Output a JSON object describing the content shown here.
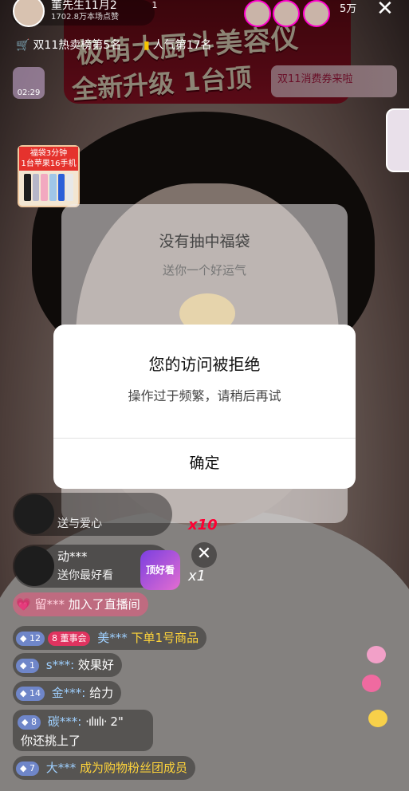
{
  "header": {
    "host_name": "董先生11月2",
    "host_likes": "1702.8万本场点赞",
    "viewer_badge": "1",
    "online_count": "5万",
    "close_icon": "close-icon"
  },
  "ranks": [
    {
      "icon": "cart-icon",
      "label": "双11热卖榜第5名"
    },
    {
      "icon": "bar-chart-icon",
      "label": "人气第17名"
    }
  ],
  "banner": {
    "line1": "极萌大厨斗美容仪",
    "line2": "全新升级 1台顶",
    "coupon": "双11消费券来啦"
  },
  "timer": {
    "time": "02:29"
  },
  "fudai": {
    "title_line1": "福袋3分钟",
    "title_line2": "1台苹果16手机",
    "phone_colors": [
      "#1d1d1d",
      "#b6b6c8",
      "#f2a9c0",
      "#9fc6e8",
      "#2b5fd8",
      "#e8e8e8"
    ]
  },
  "result_panel": {
    "title": "没有抽中福袋",
    "subtitle": "送你一个好运气"
  },
  "dialog": {
    "title": "您的访问被拒绝",
    "message": "操作过于频繁，请稍后再试",
    "confirm": "确定"
  },
  "gifts": [
    {
      "name": "",
      "desc": "送与爱心",
      "count": "x10"
    },
    {
      "name": "动***",
      "desc": "送你最好看",
      "gift_label": "顶好看",
      "count": "x1"
    }
  ],
  "chat": {
    "join": {
      "user": "留***",
      "text": "加入了直播间"
    },
    "order": {
      "level": "12",
      "club": "8",
      "club_name": "董事会",
      "user": "美***",
      "text": "下单1号商品"
    },
    "msg1": {
      "level": "1",
      "user": "s***:",
      "text": "效果好"
    },
    "msg2": {
      "level": "14",
      "user": "金***:",
      "text": "给力"
    },
    "voice": {
      "level": "8",
      "user": "碳***:",
      "duration": "2\"",
      "text": "你还挑上了"
    },
    "fans": {
      "level": "7",
      "user": "大***",
      "text": "成为购物粉丝团成员"
    }
  },
  "colors": {
    "accent": "#e0335f",
    "dialog_bg": "#ffffff",
    "highlight": "#ffd43a"
  }
}
